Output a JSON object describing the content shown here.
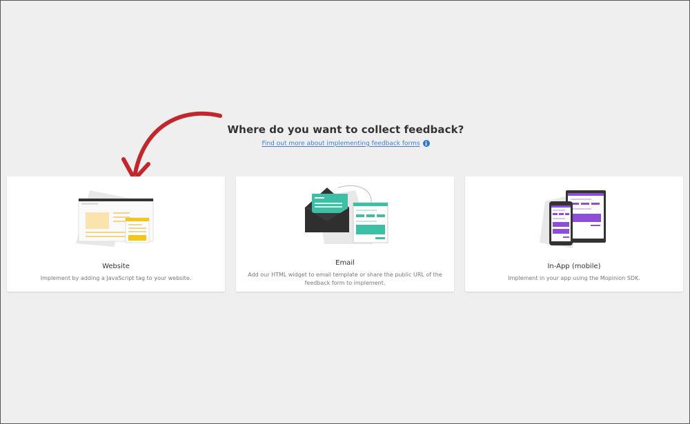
{
  "header": {
    "title": "Where do you want to collect feedback?",
    "help_link": "Find out more about implementing feedback forms"
  },
  "cards": [
    {
      "title": "Website",
      "description": "Implement by adding a JavaScript tag to your website.",
      "icon": "website-illustration"
    },
    {
      "title": "Email",
      "description": "Add our HTML widget to email template or share the public URL of the feedback form to implement.",
      "icon": "email-illustration"
    },
    {
      "title": "In-App (mobile)",
      "description": "Implement in your app using the Mopinion SDK.",
      "icon": "mobile-app-illustration"
    }
  ],
  "colors": {
    "background": "#efefef",
    "card": "#ffffff",
    "link": "#3b7dd8",
    "arrow": "#c0282d",
    "website_accent": "#f5c518",
    "email_accent": "#3dbfa5",
    "mobile_accent": "#8e4fd6"
  }
}
